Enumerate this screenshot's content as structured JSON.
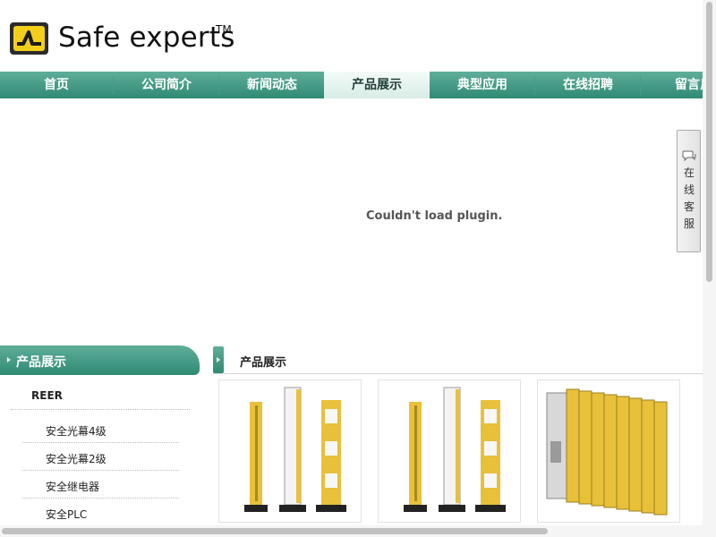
{
  "header": {
    "brand": "Safe experts",
    "trademark": "TM",
    "logo_icon": "reer-logo-icon"
  },
  "nav": {
    "items": [
      {
        "label": "首页"
      },
      {
        "label": "公司简介"
      },
      {
        "label": "新闻动态"
      },
      {
        "label": "产品展示",
        "active": true
      },
      {
        "label": "典型应用"
      },
      {
        "label": "在线招聘"
      },
      {
        "label": "留言反"
      }
    ]
  },
  "plugin": {
    "message": "Couldn't load plugin."
  },
  "service": {
    "label_chars": [
      "在",
      "线",
      "客",
      "服"
    ],
    "icon": "chat-bubble-icon"
  },
  "sidebar": {
    "title": "产品展示",
    "category": "REER",
    "items": [
      {
        "label": "安全光幕4级"
      },
      {
        "label": "安全光幕2级"
      },
      {
        "label": "安全继电器"
      },
      {
        "label": "安全PLC"
      }
    ]
  },
  "main": {
    "title": "产品展示",
    "products": [
      {
        "image": "light-curtain-image"
      },
      {
        "image": "light-curtain-image"
      },
      {
        "image": "safety-relay-image"
      }
    ]
  },
  "colors": {
    "nav_green_top": "#5fae9a",
    "nav_green_bottom": "#2f8a74",
    "logo_yellow": "#f2cf1a",
    "product_yellow": "#e8c03a"
  }
}
